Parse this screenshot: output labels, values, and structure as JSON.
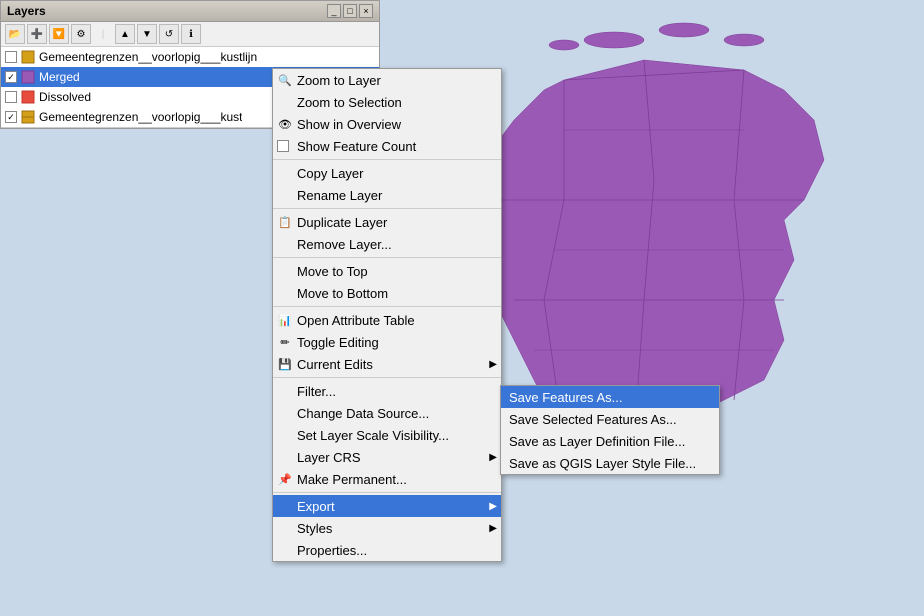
{
  "window": {
    "title": "Layers",
    "minimize_label": "_",
    "maximize_label": "□",
    "close_label": "×"
  },
  "toolbar": {
    "icons": [
      "open",
      "add",
      "filter",
      "settings",
      "move-up",
      "move-down",
      "refresh",
      "info"
    ]
  },
  "layers": [
    {
      "id": 1,
      "name": "Gemeentegrenzen__voorlopig___kustlijn",
      "checked": false,
      "selected": false,
      "icon_color": "#d4a017"
    },
    {
      "id": 2,
      "name": "Merged",
      "checked": true,
      "selected": true,
      "icon_color": "#9b59b6"
    },
    {
      "id": 3,
      "name": "Dissolved",
      "checked": false,
      "selected": false,
      "icon_color": "#e74c3c"
    },
    {
      "id": 4,
      "name": "Gemeentegrenzen__voorlopig___kust",
      "checked": true,
      "selected": false,
      "icon_color": "#d4a017"
    }
  ],
  "context_menu": {
    "items": [
      {
        "id": "zoom-to-layer",
        "label": "Zoom to Layer",
        "icon": "🔍",
        "has_icon": true,
        "separator_after": false
      },
      {
        "id": "zoom-to-selection",
        "label": "Zoom to Selection",
        "icon": "",
        "has_icon": false,
        "separator_after": false
      },
      {
        "id": "show-in-overview",
        "label": "Show in Overview",
        "icon": "👁",
        "has_icon": true,
        "separator_after": false
      },
      {
        "id": "show-feature-count",
        "label": "Show Feature Count",
        "icon": "",
        "has_icon": true,
        "is_checkbox": true,
        "separator_after": true
      },
      {
        "id": "copy-layer",
        "label": "Copy Layer",
        "icon": "",
        "has_icon": false,
        "separator_after": false
      },
      {
        "id": "rename-layer",
        "label": "Rename Layer",
        "icon": "",
        "has_icon": false,
        "separator_after": true
      },
      {
        "id": "duplicate-layer",
        "label": "Duplicate Layer",
        "icon": "📋",
        "has_icon": true,
        "separator_after": false
      },
      {
        "id": "remove-layer",
        "label": "Remove Layer...",
        "icon": "",
        "has_icon": false,
        "separator_after": true
      },
      {
        "id": "move-to-top",
        "label": "Move to Top",
        "icon": "",
        "has_icon": false,
        "separator_after": false
      },
      {
        "id": "move-to-bottom",
        "label": "Move to Bottom",
        "icon": "",
        "has_icon": false,
        "separator_after": true
      },
      {
        "id": "open-attribute-table",
        "label": "Open Attribute Table",
        "icon": "📊",
        "has_icon": true,
        "separator_after": false
      },
      {
        "id": "toggle-editing",
        "label": "Toggle Editing",
        "icon": "✏️",
        "has_icon": true,
        "separator_after": false
      },
      {
        "id": "current-edits",
        "label": "Current Edits",
        "icon": "💾",
        "has_icon": true,
        "has_submenu": true,
        "separator_after": true
      },
      {
        "id": "filter",
        "label": "Filter...",
        "icon": "",
        "has_icon": false,
        "separator_after": false
      },
      {
        "id": "change-data-source",
        "label": "Change Data Source...",
        "icon": "",
        "has_icon": false,
        "separator_after": false
      },
      {
        "id": "set-layer-scale-visibility",
        "label": "Set Layer Scale Visibility...",
        "icon": "",
        "has_icon": false,
        "separator_after": false
      },
      {
        "id": "layer-crs",
        "label": "Layer CRS",
        "icon": "",
        "has_icon": false,
        "has_submenu": true,
        "separator_after": false
      },
      {
        "id": "make-permanent",
        "label": "Make Permanent...",
        "icon": "📌",
        "has_icon": true,
        "separator_after": true
      },
      {
        "id": "export",
        "label": "Export",
        "icon": "",
        "has_icon": false,
        "has_submenu": true,
        "highlighted": true,
        "separator_after": false
      },
      {
        "id": "styles",
        "label": "Styles",
        "icon": "",
        "has_icon": false,
        "has_submenu": true,
        "separator_after": false
      },
      {
        "id": "properties",
        "label": "Properties...",
        "icon": "",
        "has_icon": false,
        "separator_after": false
      }
    ]
  },
  "submenu": {
    "items": [
      {
        "id": "save-features-as",
        "label": "Save Features As...",
        "highlighted": true
      },
      {
        "id": "save-selected-features-as",
        "label": "Save Selected Features As..."
      },
      {
        "id": "save-as-layer-definition",
        "label": "Save as Layer Definition File..."
      },
      {
        "id": "save-as-qgis-style",
        "label": "Save as QGIS Layer Style File..."
      }
    ]
  },
  "colors": {
    "accent_blue": "#3875d7",
    "menu_bg": "#f0f0f0",
    "titlebar_bg": "#d4d0c8",
    "map_water": "#c8d8e8",
    "map_land": "#9b59b6",
    "map_border": "#7d3c98"
  }
}
